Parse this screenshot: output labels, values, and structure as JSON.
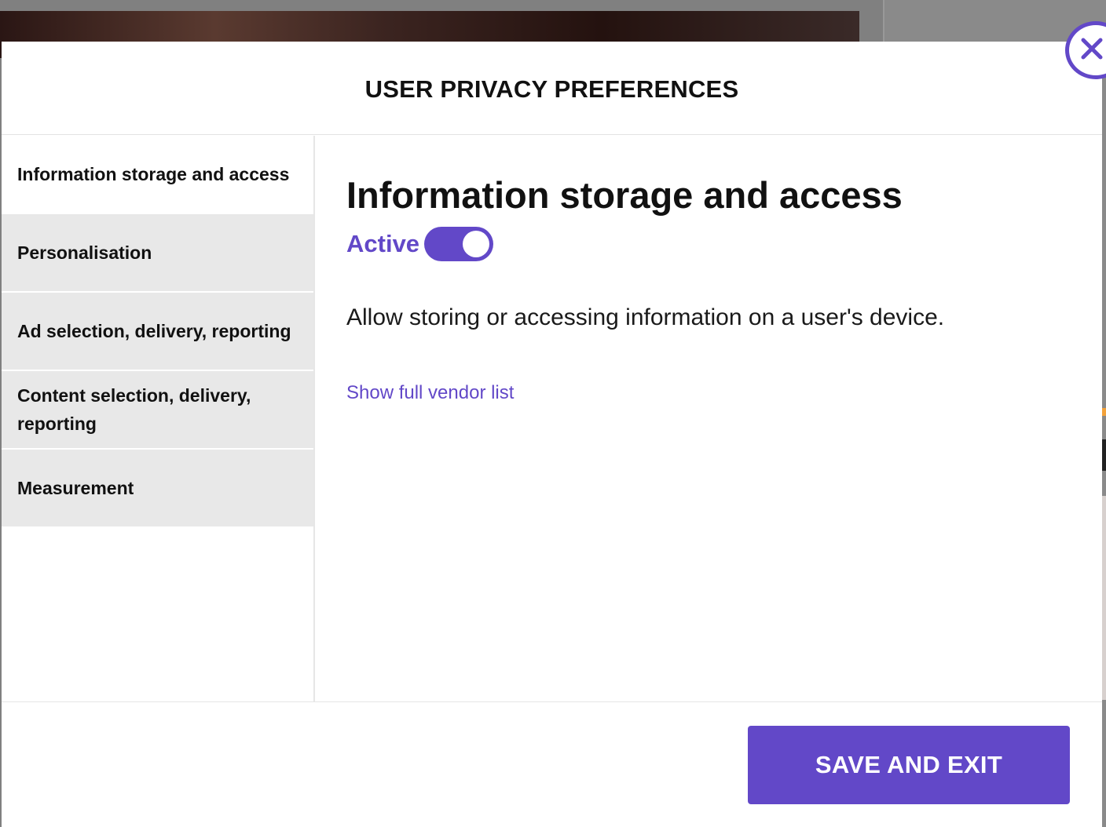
{
  "colors": {
    "accent": "#6248c8",
    "sidebar_bg": "#e8e8e8",
    "sidebar_active_bg": "#ffffff",
    "overlay": "#808080"
  },
  "modal": {
    "title": "USER PRIVACY PREFERENCES",
    "close_icon": "close-icon"
  },
  "sidebar": {
    "items": [
      {
        "label": "Information storage and access",
        "active": true
      },
      {
        "label": "Personalisation",
        "active": false
      },
      {
        "label": "Ad selection, delivery, reporting",
        "active": false
      },
      {
        "label": "Content selection, delivery, reporting",
        "active": false
      },
      {
        "label": "Measurement",
        "active": false
      }
    ]
  },
  "content": {
    "title": "Information storage and access",
    "status_label": "Active",
    "toggle_on": true,
    "description": "Allow storing or accessing information on a user's device.",
    "vendor_link": "Show full vendor list"
  },
  "footer": {
    "save_label": "SAVE AND EXIT"
  }
}
